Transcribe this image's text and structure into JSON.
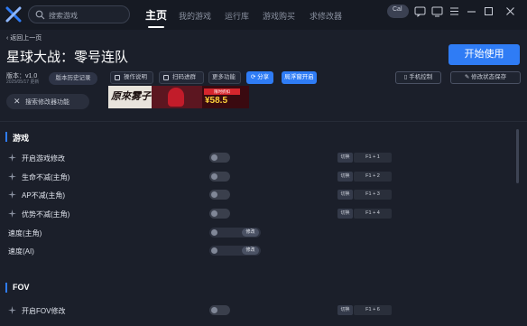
{
  "topbar": {
    "search_placeholder": "搜索游戏",
    "nav": [
      {
        "label": "主页",
        "active": true
      },
      {
        "label": "我的游戏",
        "active": false
      },
      {
        "label": "运行库",
        "active": false
      },
      {
        "label": "游戏购买",
        "active": false
      },
      {
        "label": "求修改器",
        "active": false
      }
    ],
    "avatar_text": "Cal"
  },
  "header": {
    "back_label": "返回上一页",
    "game_title": "星球大战：零号连队",
    "start_button": "开始使用",
    "version_label": "版本：v1.0",
    "version_date": "2025/05/17 更新",
    "history_button": "版本历史记录"
  },
  "toolbar": {
    "instructions": "操作说明",
    "scan_group": "扫码进群",
    "more_features": "更多功能",
    "share": "分享",
    "desktop_overlay": "局浮窗开启",
    "phone_control": "手机控制",
    "save_state": "修改状态保存"
  },
  "search_features_placeholder": "搜索修改器功能",
  "banner": {
    "brush_text": "原來雾子",
    "tag": "限时折扣",
    "price": "¥58.5"
  },
  "sections": [
    {
      "title": "游戏",
      "rows": [
        {
          "name": "开启游戏修改",
          "type": "toggle",
          "switch": "切换",
          "key": "F1 + 1"
        },
        {
          "name": "生命不减(主角)",
          "type": "toggle",
          "switch": "切换",
          "key": "F1 + 2"
        },
        {
          "name": "AP不减(主角)",
          "type": "toggle",
          "switch": "切换",
          "key": "F1 + 3"
        },
        {
          "name": "优势不减(主角)",
          "type": "toggle",
          "switch": "切换",
          "key": "F1 + 4"
        },
        {
          "name": "速度(主角)",
          "type": "slider",
          "modify": "修改"
        },
        {
          "name": "速度(AI)",
          "type": "slider",
          "modify": "修改"
        }
      ]
    },
    {
      "title": "FOV",
      "rows": [
        {
          "name": "开启FOV修改",
          "type": "toggle",
          "switch": "切换",
          "key": "F1 + 6"
        }
      ]
    }
  ],
  "colors": {
    "accent": "#2f7cf5",
    "background": "#1b1f2a",
    "topbar": "#161a23",
    "price": "#ffd43b"
  }
}
